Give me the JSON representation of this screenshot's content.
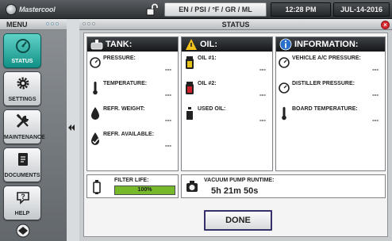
{
  "topbar": {
    "logo_text": "Mastercool",
    "units": "EN / PSI / °F / GR / ML",
    "time": "12:28 PM",
    "date": "JUL-14-2016"
  },
  "menu": {
    "title": "MENU",
    "items": [
      {
        "label": "STATUS",
        "icon": "gauge-icon",
        "active": true
      },
      {
        "label": "SETTINGS",
        "icon": "gear-icon",
        "active": false
      },
      {
        "label": "MAINTENANCE",
        "icon": "tools-icon",
        "active": false
      },
      {
        "label": "DOCUMENTS",
        "icon": "document-icon",
        "active": false
      },
      {
        "label": "HELP",
        "icon": "help-icon",
        "active": false
      }
    ]
  },
  "window": {
    "title": "STATUS",
    "close_glyph": "×"
  },
  "tank": {
    "heading": "TANK:",
    "rows": [
      {
        "label": "PRESSURE:",
        "value": "---"
      },
      {
        "label": "TEMPERATURE:",
        "value": "---"
      },
      {
        "label": "REFR. WEIGHT:",
        "value": "---"
      },
      {
        "label": "REFR. AVAILABLE:",
        "value": "---"
      }
    ]
  },
  "oil": {
    "heading": "OIL:",
    "rows": [
      {
        "label": "OIL #1:",
        "value": "---"
      },
      {
        "label": "OIL #2:",
        "value": "---"
      },
      {
        "label": "USED OIL:",
        "value": "---"
      }
    ]
  },
  "information": {
    "heading": "INFORMATION:",
    "rows": [
      {
        "label": "VEHICLE A/C PRESSURE:",
        "value": "---"
      },
      {
        "label": "DISTILLER PRESSURE:",
        "value": "---"
      },
      {
        "label": "BOARD TEMPERATURE:",
        "value": "---"
      }
    ]
  },
  "filter": {
    "label": "FILTER LIFE:",
    "percent_text": "100%",
    "level": 1.0
  },
  "vacuum": {
    "label": "VACUUM PUMP RUNTIME:",
    "value": "5h 21m 50s"
  },
  "done_label": "DONE",
  "colors": {
    "accent": "#1aa89c",
    "progress": "#76ba2c",
    "close": "#d8262d"
  }
}
